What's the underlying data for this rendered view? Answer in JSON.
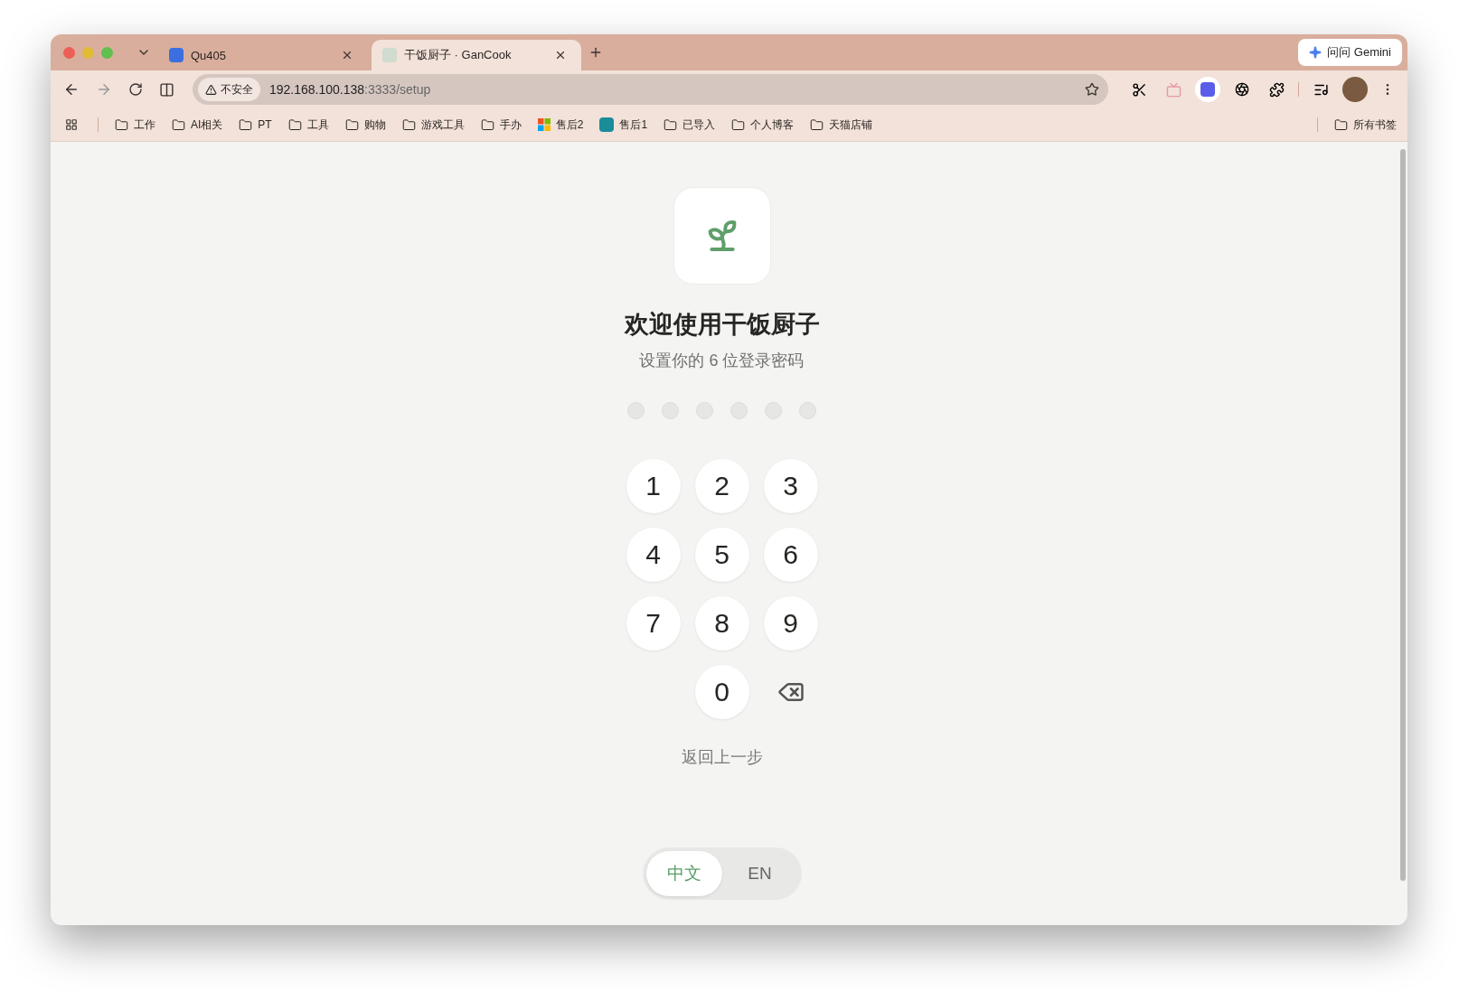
{
  "tabs": [
    {
      "title": "Qu405",
      "selected": false
    },
    {
      "title": "干饭厨子 · GanCook",
      "selected": true
    }
  ],
  "gemini_button": "问问 Gemini",
  "address_bar": {
    "security": "不安全",
    "host": "192.168.100.138",
    "rest": ":3333/setup"
  },
  "bookmarks": [
    {
      "label": "工作",
      "kind": "folder"
    },
    {
      "label": "AI相关",
      "kind": "folder"
    },
    {
      "label": "PT",
      "kind": "folder"
    },
    {
      "label": "工具",
      "kind": "folder"
    },
    {
      "label": "购物",
      "kind": "folder"
    },
    {
      "label": "游戏工具",
      "kind": "folder"
    },
    {
      "label": "手办",
      "kind": "folder"
    },
    {
      "label": "售后2",
      "kind": "tiles"
    },
    {
      "label": "售后1",
      "kind": "site"
    },
    {
      "label": "已导入",
      "kind": "folder"
    },
    {
      "label": "个人博客",
      "kind": "folder"
    },
    {
      "label": "天猫店铺",
      "kind": "folder"
    }
  ],
  "all_bookmarks": "所有书签",
  "setup": {
    "title": "欢迎使用干饭厨子",
    "subtitle": "设置你的 6 位登录密码",
    "pin_dots": [
      {
        "filled": false
      },
      {
        "filled": false
      },
      {
        "filled": false
      },
      {
        "filled": false
      },
      {
        "filled": false
      },
      {
        "filled": false
      }
    ],
    "keys": [
      {
        "kind": "digit",
        "label": "1"
      },
      {
        "kind": "digit",
        "label": "2"
      },
      {
        "kind": "digit",
        "label": "3"
      },
      {
        "kind": "digit",
        "label": "4"
      },
      {
        "kind": "digit",
        "label": "5"
      },
      {
        "kind": "digit",
        "label": "6"
      },
      {
        "kind": "digit",
        "label": "7"
      },
      {
        "kind": "digit",
        "label": "8"
      },
      {
        "kind": "digit",
        "label": "9"
      },
      {
        "kind": "blank"
      },
      {
        "kind": "digit",
        "label": "0"
      },
      {
        "kind": "backspace"
      }
    ],
    "back_link": "返回上一步",
    "languages": [
      {
        "label": "中文",
        "selected": true
      },
      {
        "label": "EN",
        "selected": false
      }
    ]
  }
}
